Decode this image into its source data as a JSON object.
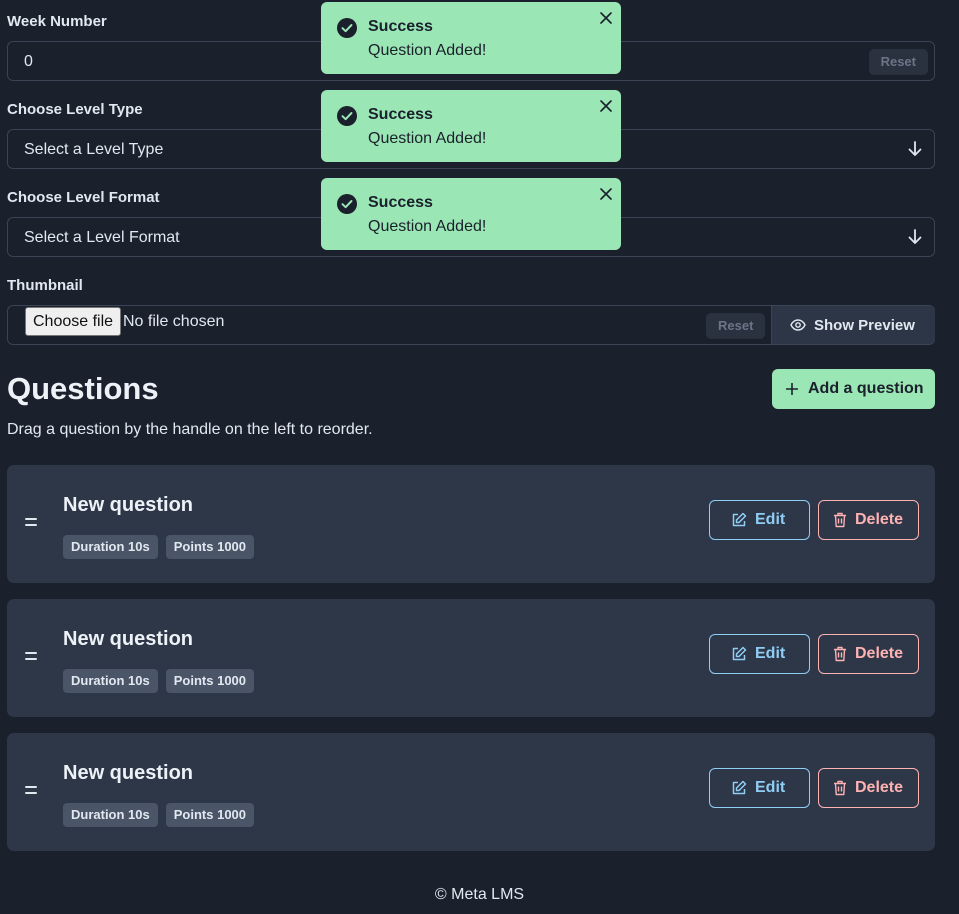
{
  "form": {
    "week_label": "Week Number",
    "week_value": "0",
    "reset_label": "Reset",
    "level_type_label": "Choose Level Type",
    "level_type_placeholder": "Select a Level Type",
    "level_format_label": "Choose Level Format",
    "level_format_placeholder": "Select a Level Format",
    "thumbnail_label": "Thumbnail",
    "choose_file_label": "Choose file",
    "no_file_text": "No file chosen",
    "show_preview_label": "Show Preview"
  },
  "questions": {
    "heading": "Questions",
    "description": "Drag a question by the handle on the left to reorder.",
    "add_label": "Add a question",
    "edit_label": "Edit",
    "delete_label": "Delete",
    "items": [
      {
        "title": "New question",
        "duration": "Duration 10s",
        "points": "Points 1000"
      },
      {
        "title": "New question",
        "duration": "Duration 10s",
        "points": "Points 1000"
      },
      {
        "title": "New question",
        "duration": "Duration 10s",
        "points": "Points 1000"
      }
    ]
  },
  "toasts": [
    {
      "title": "Success",
      "message": "Question Added!"
    },
    {
      "title": "Success",
      "message": "Question Added!"
    },
    {
      "title": "Success",
      "message": "Question Added!"
    }
  ],
  "footer": "© Meta LMS",
  "colors": {
    "background": "#1a202c",
    "card": "#2d3748",
    "success": "#9ae6b4",
    "edit": "#90cdf4",
    "delete": "#feb2b2"
  }
}
